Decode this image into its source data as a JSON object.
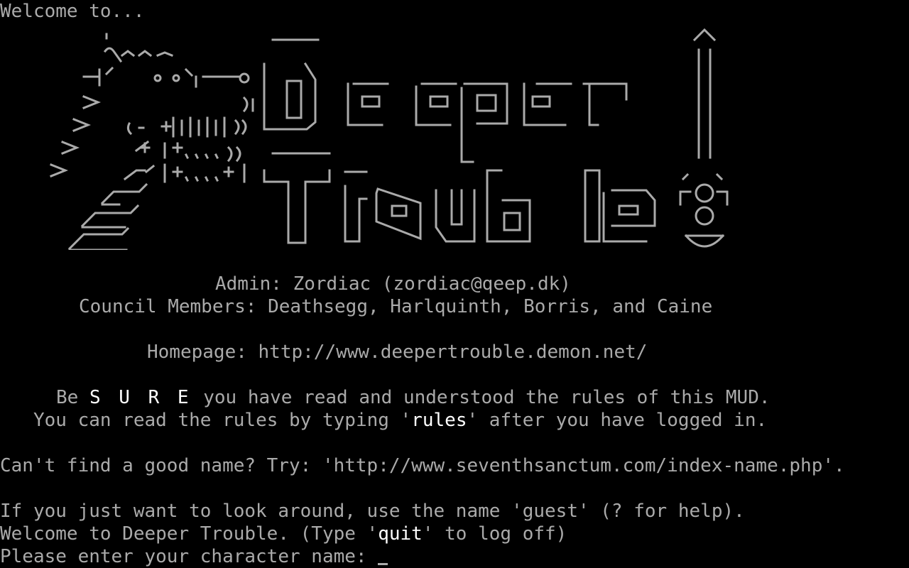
{
  "terminal": {
    "welcome_line": "Welcome to...",
    "admin_line": "Admin: Zordiac (zordiac@qeep.dk)",
    "council_line": "Council Members: Deathsegg, Harlquinth, Borris, and Caine",
    "homepage_line": "Homepage: http://www.deepertrouble.demon.net/",
    "rules_line1": {
      "prefix": "Be ",
      "emphasis": "S U R E",
      "suffix": " you have read and understood the rules of this MUD."
    },
    "rules_line2": {
      "prefix": "You can read the rules by typing '",
      "command": "rules",
      "suffix": "' after you have logged in."
    },
    "name_hint_line": "Can't find a good name? Try: 'http://www.seventhsanctum.com/index-name.php'.",
    "guest_line": "If you just want to look around, use the name 'guest' (? for help).",
    "welcome_deeper_line": {
      "prefix": "Welcome to Deeper Trouble. (Type '",
      "command": "quit",
      "suffix": "' to log off)"
    },
    "prompt_line": "Please enter your character name: "
  },
  "banner": {
    "title_word1": "Deeper",
    "title_word2": "Trouble",
    "exclamation": "!"
  },
  "colors": {
    "background": "#000000",
    "text": "#aaaaaa",
    "bright_text": "#ffffff"
  },
  "icons": [
    "dragon-rider-ascii-art",
    "exclamation-sword-ascii-art"
  ]
}
